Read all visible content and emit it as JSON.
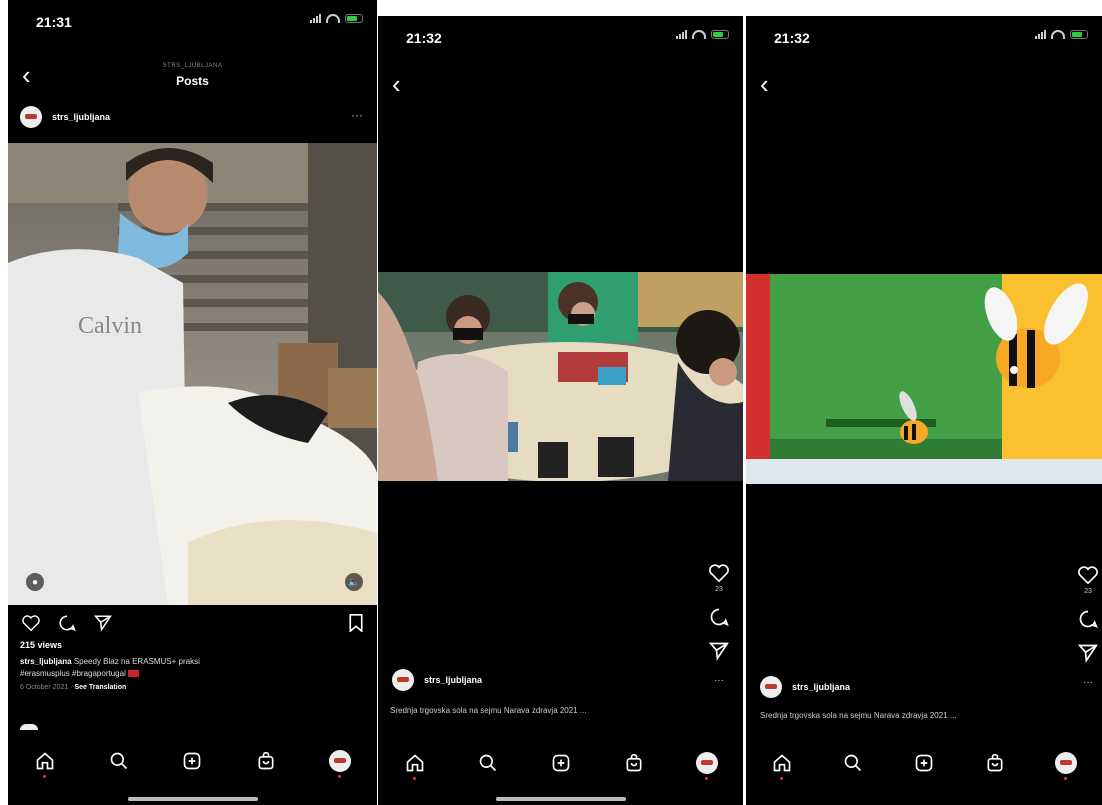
{
  "screen1": {
    "time": "21:31",
    "header_subtitle": "STRS_LJUBLJANA",
    "header_title": "Posts",
    "username": "strs_ljubljana",
    "more": "···",
    "views": "215 views",
    "caption_user": "strs_ljubljana",
    "caption_text": "Speedy Blaz na ERASMUS+ praksi",
    "caption_tags": "#erasmusplus #bragaportugal",
    "date": "6 October 2021",
    "see_translation": "See Translation",
    "sweater_text": "Calvin"
  },
  "screen2": {
    "time": "21:32",
    "likes": "23",
    "username": "strs_ljubljana",
    "caption": "Srednja trgovska sola na sejmu Narava zdravja 2021 ...",
    "more": "···"
  },
  "screen3": {
    "time": "21:32",
    "likes": "23",
    "username": "strs_ljubljana",
    "caption": "Srednja trgovska sola na sejmu Narava zdravja 2021 ...",
    "more": "···"
  },
  "colors": {
    "background": "#000000",
    "text": "#ffffff",
    "accent_red": "#e53935"
  },
  "icons": [
    "chevron-left-icon",
    "heart-icon",
    "comment-icon",
    "share-icon",
    "bookmark-icon",
    "home-icon",
    "search-icon",
    "add-icon",
    "shop-icon",
    "profile-icon",
    "user-tag-icon",
    "sound-icon"
  ]
}
